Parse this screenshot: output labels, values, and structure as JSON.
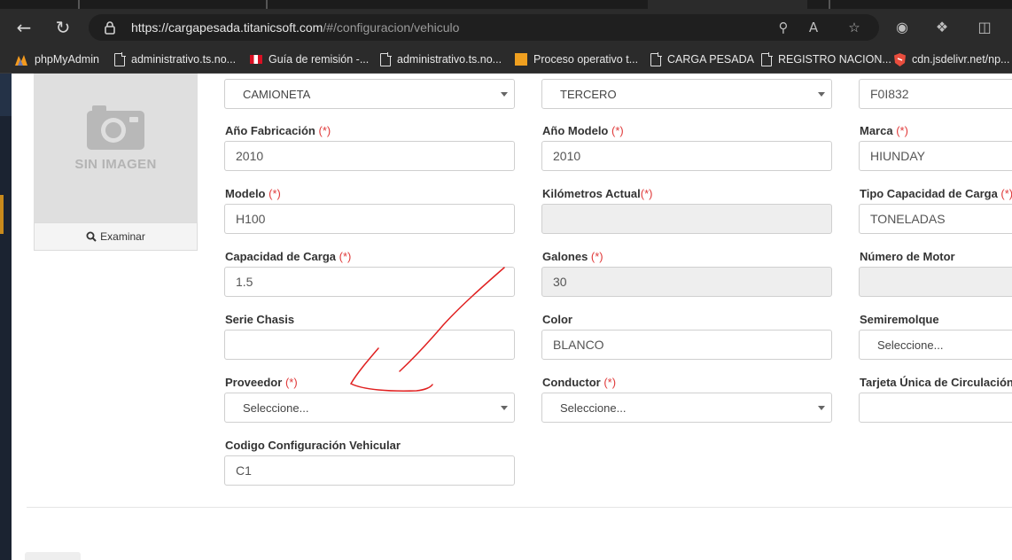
{
  "browser": {
    "url_host": "https://cargapesada.titanicsoft.com",
    "url_path": "/#/configuracion/vehiculo",
    "bookmarks": [
      {
        "label": "phpMyAdmin",
        "icon": "phpmyadmin-icon"
      },
      {
        "label": "administrativo.ts.no...",
        "icon": "page-icon"
      },
      {
        "label": "Guía de remisión -...",
        "icon": "peru-flag-icon"
      },
      {
        "label": "administrativo.ts.no...",
        "icon": "page-icon"
      },
      {
        "label": "Proceso operativo t...",
        "icon": "orange-app-icon"
      },
      {
        "label": "CARGA PESADA",
        "icon": "page-icon"
      },
      {
        "label": "REGISTRO NACION...",
        "icon": "page-icon"
      },
      {
        "label": "cdn.jsdelivr.net/np...",
        "icon": "jsdelivr-icon"
      }
    ]
  },
  "photo": {
    "placeholder_text": "SIN IMAGEN",
    "browse_label": "Examinar"
  },
  "form": {
    "required_mark": "(*)",
    "row0": {
      "col1_value": "CAMIONETA",
      "col2_value": "TERCERO",
      "col3_value": "F0I832"
    },
    "anio_fabricacion": {
      "label": "Año Fabricación",
      "value": "2010"
    },
    "anio_modelo": {
      "label": "Año Modelo",
      "value": "2010"
    },
    "marca": {
      "label": "Marca",
      "value": "HIUNDAY"
    },
    "modelo": {
      "label": "Modelo",
      "value": "H100"
    },
    "kilometros": {
      "label": "Kilómetros Actual",
      "value": ""
    },
    "tipo_capacidad": {
      "label": "Tipo Capacidad de Carga",
      "value": "TONELADAS"
    },
    "capacidad": {
      "label": "Capacidad de Carga",
      "value": "1.5"
    },
    "galones": {
      "label": "Galones",
      "value": "30"
    },
    "numero_motor": {
      "label": "Número de Motor",
      "value": ""
    },
    "serie_chasis": {
      "label": "Serie Chasis",
      "value": ""
    },
    "color": {
      "label": "Color",
      "value": "BLANCO"
    },
    "semiremolque": {
      "label": "Semiremolque",
      "value": "Seleccione..."
    },
    "proveedor": {
      "label": "Proveedor",
      "value": "Seleccione..."
    },
    "conductor": {
      "label": "Conductor",
      "value": "Seleccione..."
    },
    "tarjeta": {
      "label": "Tarjeta Única de Circulación",
      "value": ""
    },
    "codigo_config": {
      "label": "Codigo Configuración Vehicular",
      "value": "C1"
    }
  },
  "annotation": {
    "color": "#e02020"
  }
}
